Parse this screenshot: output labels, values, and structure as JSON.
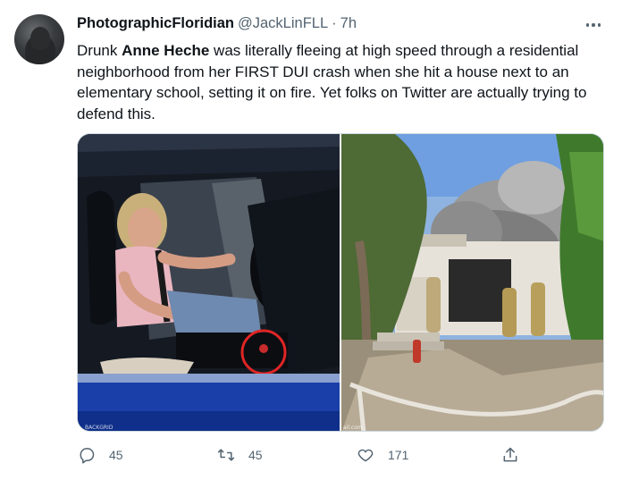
{
  "tweet": {
    "author": {
      "display_name": "PhotographicFloridian",
      "handle": "@JackLinFLL",
      "separator": "·",
      "time_ago": "7h"
    },
    "text_parts": {
      "before": "Drunk ",
      "bold": "Anne Heche",
      "after": " was literally fleeing at high speed through a residential neighborhood from her FIRST DUI crash when she hit a house next to an elementary school, setting it on fire. Yet folks on Twitter are actually trying to defend this."
    },
    "media": {
      "left_watermark": "BACKGRID",
      "right_watermark": "ail.com"
    },
    "actions": {
      "reply": {
        "icon": "reply-icon",
        "count": "45"
      },
      "retweet": {
        "icon": "retweet-icon",
        "count": "45"
      },
      "like": {
        "icon": "heart-icon",
        "count": "171"
      },
      "share": {
        "icon": "share-icon"
      }
    },
    "more_icon": "more-options-icon"
  },
  "colors": {
    "text_primary": "#0f1419",
    "text_secondary": "#536471",
    "border": "#cfd9de"
  }
}
